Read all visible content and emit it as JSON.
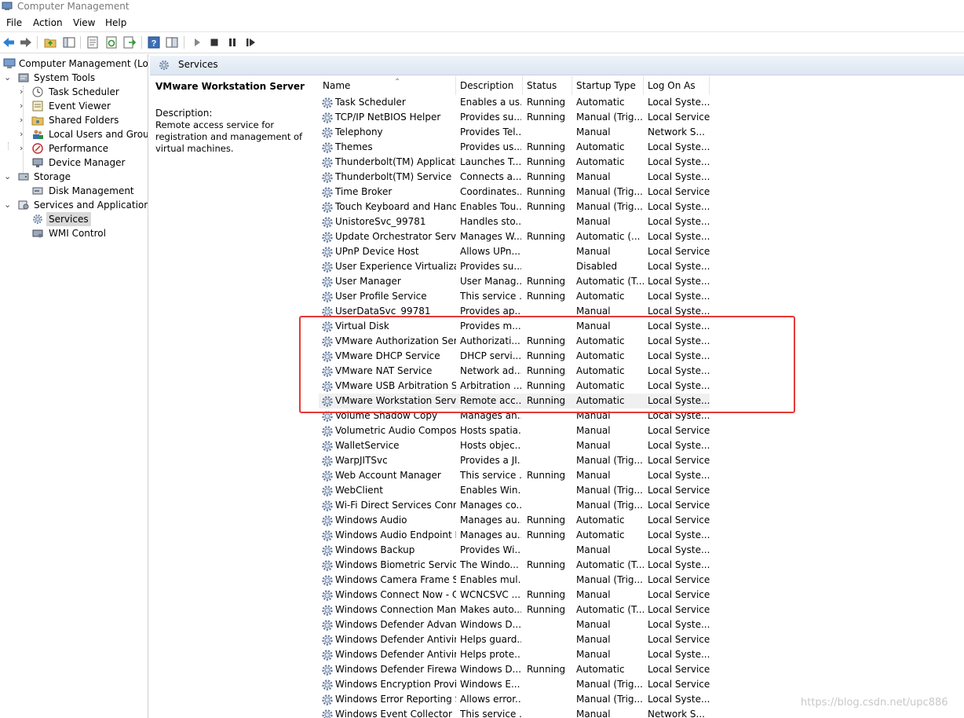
{
  "window": {
    "title": "Computer Management"
  },
  "menu": [
    "File",
    "Action",
    "View",
    "Help"
  ],
  "toolbar": [
    "back-icon",
    "forward-icon",
    "up-folder-icon",
    "show-hide-tree-icon",
    "properties-icon",
    "refresh-icon",
    "export-list-icon",
    "help-icon",
    "console-view-icon",
    "play-icon",
    "stop-icon",
    "pause-icon",
    "restart-icon"
  ],
  "tree": [
    {
      "label": "Computer Management (Local",
      "level": 0,
      "chev": "",
      "icon": "computer-icon"
    },
    {
      "label": "System Tools",
      "level": 0,
      "chev": "v",
      "icon": "tools-icon"
    },
    {
      "label": "Task Scheduler",
      "level": 1,
      "chev": ">",
      "icon": "clock-icon"
    },
    {
      "label": "Event Viewer",
      "level": 1,
      "chev": ">",
      "icon": "event-viewer-icon"
    },
    {
      "label": "Shared Folders",
      "level": 1,
      "chev": ">",
      "icon": "shared-folder-icon"
    },
    {
      "label": "Local Users and Groups",
      "level": 1,
      "chev": ">",
      "icon": "users-icon"
    },
    {
      "label": "Performance",
      "level": 1,
      "chev": ">",
      "icon": "performance-icon"
    },
    {
      "label": "Device Manager",
      "level": 1,
      "chev": "",
      "icon": "device-manager-icon"
    },
    {
      "label": "Storage",
      "level": 0,
      "chev": "v",
      "icon": "storage-icon"
    },
    {
      "label": "Disk Management",
      "level": 1,
      "chev": "",
      "icon": "disk-icon"
    },
    {
      "label": "Services and Applications",
      "level": 0,
      "chev": "v",
      "icon": "services-apps-icon"
    },
    {
      "label": "Services",
      "level": 1,
      "chev": "",
      "icon": "gear-icon",
      "selected": true
    },
    {
      "label": "WMI Control",
      "level": 1,
      "chev": "",
      "icon": "wmi-icon"
    }
  ],
  "header": {
    "title": "Services"
  },
  "details": {
    "name": "VMware Workstation Server",
    "desc_label": "Description:",
    "desc_text": "Remote access service for registration and management of virtual machines."
  },
  "columns": [
    "Name",
    "Description",
    "Status",
    "Startup Type",
    "Log On As"
  ],
  "rows": [
    [
      "Task Scheduler",
      "Enables a us...",
      "Running",
      "Automatic",
      "Local Syste..."
    ],
    [
      "TCP/IP NetBIOS Helper",
      "Provides su...",
      "Running",
      "Manual (Trig...",
      "Local Service"
    ],
    [
      "Telephony",
      "Provides Tel...",
      "",
      "Manual",
      "Network S..."
    ],
    [
      "Themes",
      "Provides us...",
      "Running",
      "Automatic",
      "Local Syste..."
    ],
    [
      "Thunderbolt(TM) Applicatio...",
      "Launches T...",
      "Running",
      "Automatic",
      "Local Syste..."
    ],
    [
      "Thunderbolt(TM) Service",
      "Connects a...",
      "Running",
      "Manual",
      "Local Syste..."
    ],
    [
      "Time Broker",
      "Coordinates...",
      "Running",
      "Manual (Trig...",
      "Local Service"
    ],
    [
      "Touch Keyboard and Hand...",
      "Enables Tou...",
      "Running",
      "Manual (Trig...",
      "Local Syste..."
    ],
    [
      "UnistoreSvc_99781",
      "Handles sto...",
      "",
      "Manual",
      "Local Syste..."
    ],
    [
      "Update Orchestrator Service",
      "Manages W...",
      "Running",
      "Automatic (...",
      "Local Syste..."
    ],
    [
      "UPnP Device Host",
      "Allows UPn...",
      "",
      "Manual",
      "Local Service"
    ],
    [
      "User Experience Virtualizati...",
      "Provides su...",
      "",
      "Disabled",
      "Local Syste..."
    ],
    [
      "User Manager",
      "User Manag...",
      "Running",
      "Automatic (T...",
      "Local Syste..."
    ],
    [
      "User Profile Service",
      "This service ...",
      "Running",
      "Automatic",
      "Local Syste..."
    ],
    [
      "UserDataSvc_99781",
      "Provides ap...",
      "",
      "Manual",
      "Local Syste..."
    ],
    [
      "Virtual Disk",
      "Provides m...",
      "",
      "Manual",
      "Local Syste..."
    ],
    [
      "VMware Authorization Servi...",
      "Authorizati...",
      "Running",
      "Automatic",
      "Local Syste..."
    ],
    [
      "VMware DHCP Service",
      "DHCP servi...",
      "Running",
      "Automatic",
      "Local Syste..."
    ],
    [
      "VMware NAT Service",
      "Network ad...",
      "Running",
      "Automatic",
      "Local Syste..."
    ],
    [
      "VMware USB Arbitration Ser...",
      "Arbitration ...",
      "Running",
      "Automatic",
      "Local Syste..."
    ],
    [
      "VMware Workstation Server",
      "Remote acc...",
      "Running",
      "Automatic",
      "Local Syste..."
    ],
    [
      "Volume Shadow Copy",
      "Manages an...",
      "",
      "Manual",
      "Local Syste..."
    ],
    [
      "Volumetric Audio Composit...",
      "Hosts spatia...",
      "",
      "Manual",
      "Local Service"
    ],
    [
      "WalletService",
      "Hosts objec...",
      "",
      "Manual",
      "Local Syste..."
    ],
    [
      "WarpJITSvc",
      "Provides a JI...",
      "",
      "Manual (Trig...",
      "Local Service"
    ],
    [
      "Web Account Manager",
      "This service ...",
      "Running",
      "Manual",
      "Local Syste..."
    ],
    [
      "WebClient",
      "Enables Win...",
      "",
      "Manual (Trig...",
      "Local Service"
    ],
    [
      "Wi-Fi Direct Services Conne...",
      "Manages co...",
      "",
      "Manual (Trig...",
      "Local Service"
    ],
    [
      "Windows Audio",
      "Manages au...",
      "Running",
      "Automatic",
      "Local Service"
    ],
    [
      "Windows Audio Endpoint B...",
      "Manages au...",
      "Running",
      "Automatic",
      "Local Syste..."
    ],
    [
      "Windows Backup",
      "Provides Wi...",
      "",
      "Manual",
      "Local Syste..."
    ],
    [
      "Windows Biometric Service",
      "The Windo...",
      "Running",
      "Automatic (T...",
      "Local Syste..."
    ],
    [
      "Windows Camera Frame Se...",
      "Enables mul...",
      "",
      "Manual (Trig...",
      "Local Service"
    ],
    [
      "Windows Connect Now - C...",
      "WCNCSVC ...",
      "Running",
      "Manual",
      "Local Service"
    ],
    [
      "Windows Connection Mana...",
      "Makes auto...",
      "Running",
      "Automatic (T...",
      "Local Service"
    ],
    [
      "Windows Defender Advanc...",
      "Windows D...",
      "",
      "Manual",
      "Local Syste..."
    ],
    [
      "Windows Defender Antiviru...",
      "Helps guard...",
      "",
      "Manual",
      "Local Service"
    ],
    [
      "Windows Defender Antiviru...",
      "Helps prote...",
      "",
      "Manual",
      "Local Syste..."
    ],
    [
      "Windows Defender Firewall",
      "Windows D...",
      "Running",
      "Automatic",
      "Local Service"
    ],
    [
      "Windows Encryption Provid...",
      "Windows E...",
      "",
      "Manual (Trig...",
      "Local Service"
    ],
    [
      "Windows Error Reporting Se...",
      "Allows error...",
      "",
      "Manual (Trig...",
      "Local Syste..."
    ],
    [
      "Windows Event Collector",
      "This service ...",
      "",
      "Manual",
      "Network S..."
    ]
  ],
  "selected_row": 20,
  "highlight": {
    "from_row": 15,
    "to_row": 20,
    "color": "#e53935"
  },
  "watermark": "https://blog.csdn.net/upc886"
}
